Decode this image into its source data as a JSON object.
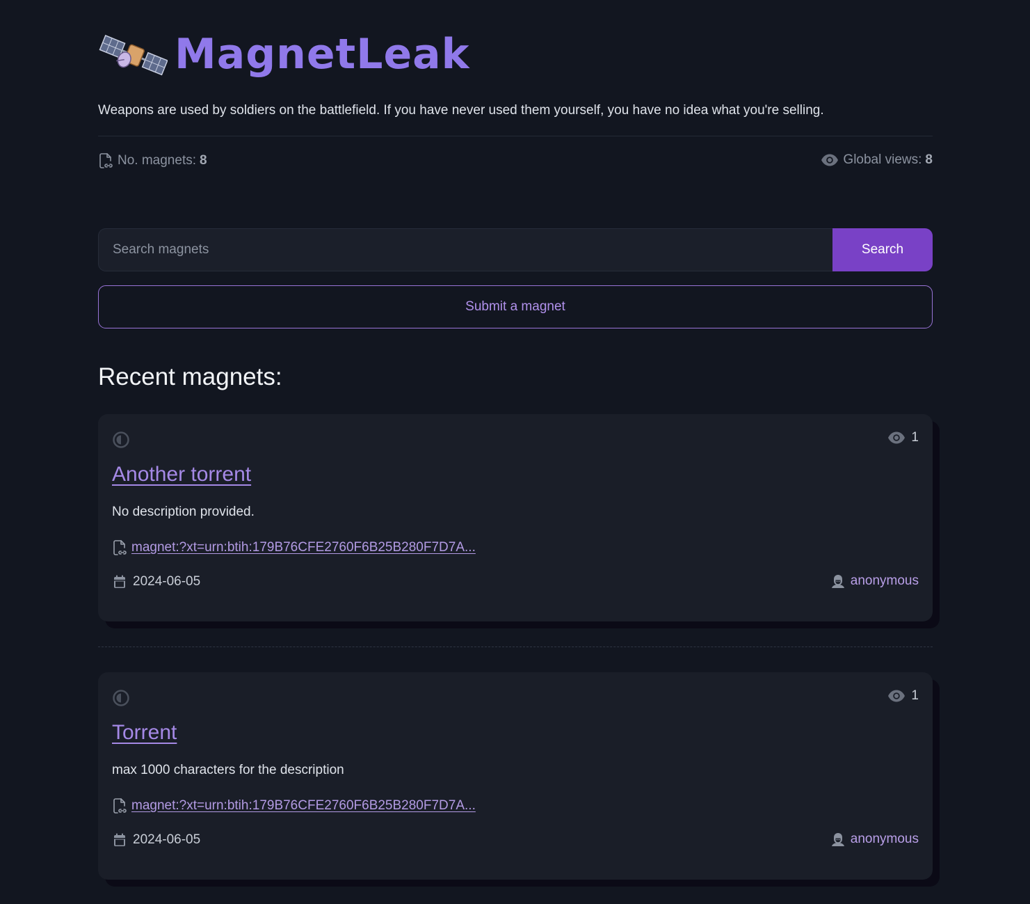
{
  "site": {
    "name": "MagnetLeak",
    "logo_icon": "satellite-icon",
    "tagline": "Weapons are used by soldiers on the battlefield. If you have never used them yourself, you have no idea what you're selling.",
    "accent_color": "#9079ea"
  },
  "stats": {
    "magnets_label": "No. magnets:",
    "magnets_count": "8",
    "views_label": "Global views:",
    "views_count": "8"
  },
  "search": {
    "placeholder": "Search magnets",
    "button_label": "Search",
    "button_color": "#7941c6"
  },
  "submit": {
    "label": "Submit a magnet"
  },
  "recent": {
    "heading": "Recent magnets:",
    "items": [
      {
        "title": "Another torrent",
        "description": "No description provided.",
        "magnet": "magnet:?xt=urn:btih:179B76CFE2760F6B25B280F7D7A...",
        "date": "2024-06-05",
        "author": "anonymous",
        "views": "1"
      },
      {
        "title": "Torrent",
        "description": "max 1000 characters for the description",
        "magnet": "magnet:?xt=urn:btih:179B76CFE2760F6B25B280F7D7A...",
        "date": "2024-06-05",
        "author": "anonymous",
        "views": "1"
      }
    ]
  }
}
